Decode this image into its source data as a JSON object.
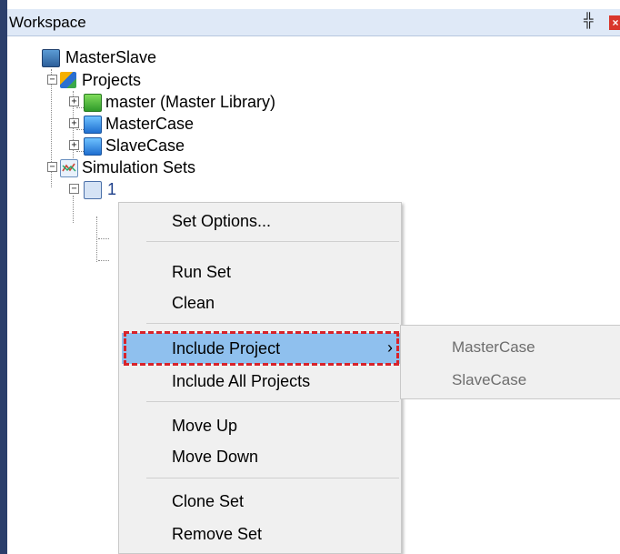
{
  "window": {
    "title": "Workspace"
  },
  "tree": {
    "root": "MasterSlave",
    "projects_label": "Projects",
    "projects": [
      "master (Master Library)",
      "MasterCase",
      "SlaveCase"
    ],
    "sim_sets_label": "Simulation Sets",
    "set_label": "1"
  },
  "context_menu": {
    "items": [
      "Set Options...",
      "Run Set",
      "Clean",
      "Include Project",
      "Include All Projects",
      "Move Up",
      "Move Down",
      "Clone Set",
      "Remove Set"
    ],
    "highlighted": "Include Project"
  },
  "submenu": {
    "items": [
      "MasterCase",
      "SlaveCase"
    ]
  },
  "colors": {
    "titlebar": "#dfe9f7",
    "menu_bg": "#f0f0f0",
    "highlight": "#8fc0ee",
    "dashed_box": "#d8232a",
    "disabled_text": "#6d6d6d"
  }
}
